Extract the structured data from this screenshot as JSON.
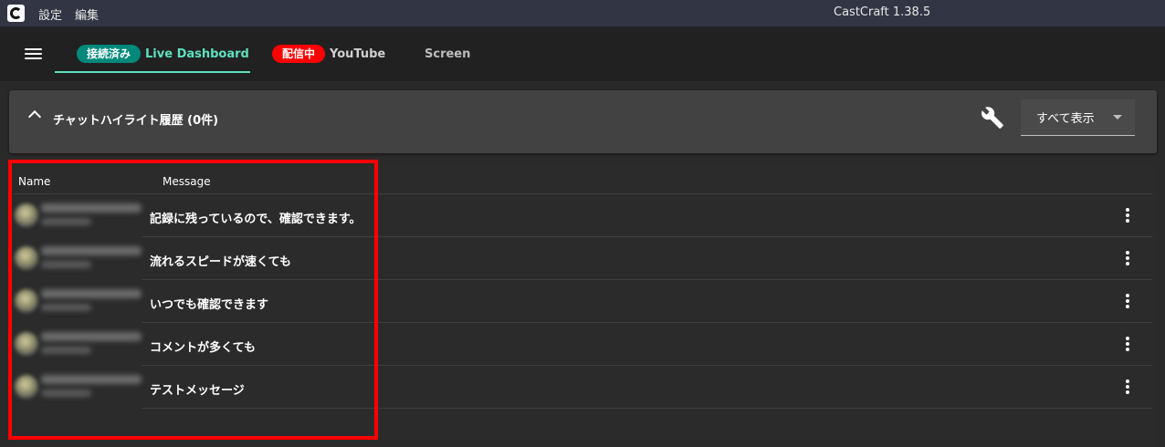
{
  "window": {
    "title": "CastCraft 1.38.5",
    "menu": [
      "設定",
      "編集"
    ]
  },
  "tabs": [
    {
      "badge": "接続済み",
      "badge_color": "#00897b",
      "label": "Live Dashboard",
      "label_color": "#5ce1c0",
      "active": true
    },
    {
      "badge": "配信中",
      "badge_color": "#ff0000",
      "label": "YouTube",
      "label_color": "#cfcfcf",
      "active": false
    },
    {
      "badge": "",
      "label": "Screen",
      "label_color": "#bdbdbd",
      "active": false
    }
  ],
  "panel": {
    "title": "チャットハイライト履歴 (0件)",
    "filter_value": "すべて表示"
  },
  "table": {
    "columns": [
      "Name",
      "Message"
    ],
    "rows": [
      {
        "message": "記録に残っているので、確認できます。"
      },
      {
        "message": "流れるスピードが速くても"
      },
      {
        "message": "いつでも確認できます"
      },
      {
        "message": "コメントが多くても"
      },
      {
        "message": "テストメッセージ"
      }
    ]
  },
  "colors": {
    "accent": "#5ce1c0",
    "connected_badge": "#00897b",
    "live_badge": "#ff0000",
    "annotation": "#ff0000"
  },
  "icons": {
    "logo": "castcraft-logo-icon",
    "menu": "hamburger-menu-icon",
    "collapse": "chevron-up-icon",
    "settings": "wrench-icon",
    "dropdown": "caret-down-icon",
    "row_menu": "more-vertical-icon"
  }
}
